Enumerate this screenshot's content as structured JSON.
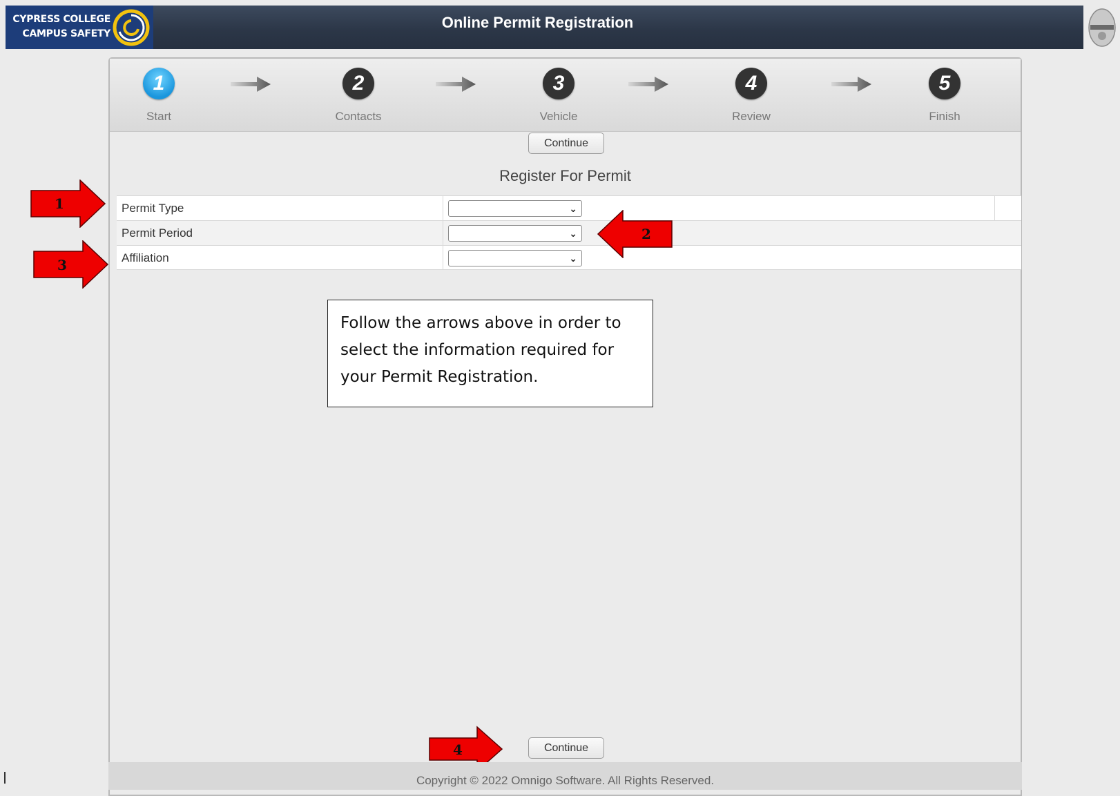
{
  "header": {
    "logo_line1": "CYPRESS COLLEGE",
    "logo_line2": "CAMPUS SAFETY",
    "title": "Online Permit Registration"
  },
  "steps": [
    {
      "number": "1",
      "label": "Start",
      "active": true
    },
    {
      "number": "2",
      "label": "Contacts",
      "active": false
    },
    {
      "number": "3",
      "label": "Vehicle",
      "active": false
    },
    {
      "number": "4",
      "label": "Review",
      "active": false
    },
    {
      "number": "5",
      "label": "Finish",
      "active": false
    }
  ],
  "buttons": {
    "continue_top": "Continue",
    "continue_bottom": "Continue"
  },
  "form": {
    "title": "Register For Permit",
    "rows": [
      {
        "label": "Permit Type",
        "value": ""
      },
      {
        "label": "Permit Period",
        "value": ""
      },
      {
        "label": "Affiliation",
        "value": ""
      }
    ]
  },
  "annotations": {
    "arrow1": "1",
    "arrow2": "2",
    "arrow3": "3",
    "arrow4": "4",
    "note_line1": "Follow the arrows above in order to",
    "note_line2": "select the information required for",
    "note_line3": "your Permit Registration."
  },
  "footer": {
    "copyright": "Copyright © 2022 Omnigo Software. All Rights Reserved."
  },
  "colors": {
    "header_bg": "#2c3748",
    "active_step": "#1a96dd",
    "inactive_step": "#333333",
    "annotation_red": "#ee0000"
  }
}
